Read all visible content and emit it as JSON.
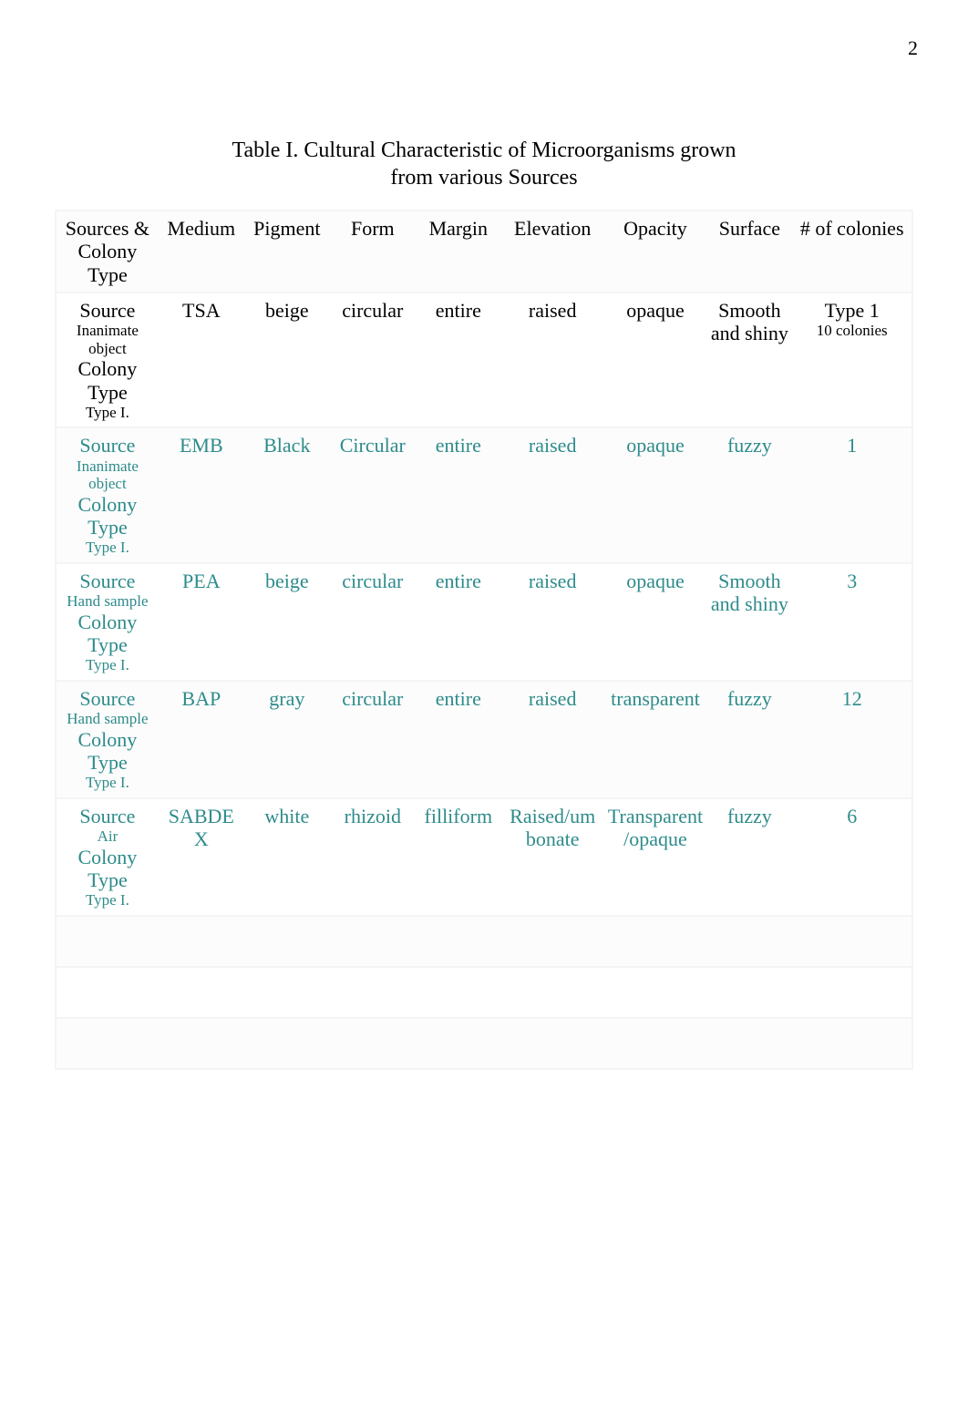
{
  "page_number": "2",
  "title_line1": "Table I. Cultural Characteristic of Microorganisms grown",
  "title_line2": "from various Sources",
  "headers": {
    "sources": "Sources & Colony Type",
    "medium": "Medium",
    "pigment": "Pigment",
    "form": "Form",
    "margin": "Margin",
    "elevation": "Elevation",
    "opacity": "Opacity",
    "surface": "Surface",
    "colonies": "# of colonies"
  },
  "chart_data": {
    "type": "table",
    "title": "Table I. Cultural Characteristic of Microorganisms grown from various Sources",
    "columns": [
      "Sources & Colony Type",
      "Medium",
      "Pigment",
      "Form",
      "Margin",
      "Elevation",
      "Opacity",
      "Surface",
      "# of colonies"
    ],
    "rows": [
      {
        "source_label": "Source",
        "source_detail": "Inanimate object",
        "colony_label": "Colony Type",
        "colony_type": "Type I.",
        "medium": "TSA",
        "pigment": "beige",
        "form": "circular",
        "margin": "entire",
        "elevation": "raised",
        "opacity": "opaque",
        "surface": "Smooth and shiny",
        "colonies_main": "Type 1",
        "colonies_sub": "10 colonies",
        "teal": false
      },
      {
        "source_label": "Source",
        "source_detail": "Inanimate object",
        "colony_label": "Colony Type",
        "colony_type": "Type I.",
        "medium": "EMB",
        "pigment": "Black",
        "form": "Circular",
        "margin": "entire",
        "elevation": "raised",
        "opacity": "opaque",
        "surface": "fuzzy",
        "colonies_main": "1",
        "colonies_sub": "",
        "teal": true
      },
      {
        "source_label": "Source",
        "source_detail": "Hand sample",
        "colony_label": "Colony Type",
        "colony_type": "Type I.",
        "medium": "PEA",
        "pigment": "beige",
        "form": "circular",
        "margin": "entire",
        "elevation": "raised",
        "opacity": "opaque",
        "surface": "Smooth and shiny",
        "colonies_main": "3",
        "colonies_sub": "",
        "teal": true
      },
      {
        "source_label": "Source",
        "source_detail": "Hand sample",
        "colony_label": "Colony Type",
        "colony_type": "Type I.",
        "medium": "BAP",
        "pigment": "gray",
        "form": "circular",
        "margin": "entire",
        "elevation": "raised",
        "opacity": "transparent",
        "surface": "fuzzy",
        "colonies_main": "12",
        "colonies_sub": "",
        "teal": true
      },
      {
        "source_label": "Source",
        "source_detail": "Air",
        "colony_label": "Colony Type",
        "colony_type": "Type I.",
        "medium": "SABDEX",
        "pigment": "white",
        "form": "rhizoid",
        "margin": "filliform",
        "elevation": "Raised/umbonate",
        "opacity": "Transparent/opaque",
        "surface": "fuzzy",
        "colonies_main": "6",
        "colonies_sub": "",
        "teal": true
      }
    ]
  }
}
